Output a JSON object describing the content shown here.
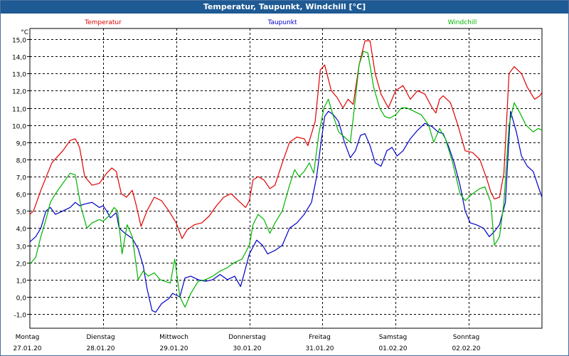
{
  "window_title": "Temperatur, Taupunkt, Windchill [°C]",
  "chart_data": {
    "type": "line",
    "title": "Temperatur, Taupunkt, Windchill [°C]",
    "yunit": "°C",
    "ylim": [
      -1.0,
      15.0
    ],
    "ytick_labels": [
      "-1,0",
      "0,0",
      "1,0",
      "2,0",
      "3,0",
      "4,0",
      "5,0",
      "6,0",
      "7,0",
      "8,0",
      "9,0",
      "10,0",
      "11,0",
      "12,0",
      "13,0",
      "14,0",
      "15,0"
    ],
    "x_range_days": [
      0,
      7
    ],
    "day_labels": [
      {
        "weekday": "Montag",
        "date": "27.01.20"
      },
      {
        "weekday": "Dienstag",
        "date": "28.01.20"
      },
      {
        "weekday": "Mittwoch",
        "date": "29.01.20"
      },
      {
        "weekday": "Donnerstag",
        "date": "30.01.20"
      },
      {
        "weekday": "Freitag",
        "date": "31.01.20"
      },
      {
        "weekday": "Samstag",
        "date": "01.02.20"
      },
      {
        "weekday": "Sonntag",
        "date": "02.02.20"
      }
    ],
    "grid": true,
    "legend_position": "top",
    "series": [
      {
        "name": "Temperatur",
        "color": "#e00000",
        "points": [
          [
            0,
            4.8
          ],
          [
            0.05,
            5.0
          ],
          [
            0.15,
            6.2
          ],
          [
            0.3,
            7.8
          ],
          [
            0.45,
            8.5
          ],
          [
            0.55,
            9.1
          ],
          [
            0.62,
            9.2
          ],
          [
            0.68,
            8.7
          ],
          [
            0.75,
            7.0
          ],
          [
            0.85,
            6.5
          ],
          [
            0.95,
            6.6
          ],
          [
            1.05,
            7.2
          ],
          [
            1.12,
            7.5
          ],
          [
            1.18,
            7.3
          ],
          [
            1.25,
            6.0
          ],
          [
            1.32,
            5.8
          ],
          [
            1.4,
            6.2
          ],
          [
            1.45,
            5.4
          ],
          [
            1.52,
            4.1
          ],
          [
            1.6,
            5.0
          ],
          [
            1.7,
            5.8
          ],
          [
            1.8,
            5.6
          ],
          [
            1.9,
            5.0
          ],
          [
            2.0,
            4.3
          ],
          [
            2.08,
            3.4
          ],
          [
            2.15,
            3.9
          ],
          [
            2.25,
            4.2
          ],
          [
            2.35,
            4.3
          ],
          [
            2.45,
            4.7
          ],
          [
            2.55,
            5.3
          ],
          [
            2.65,
            5.8
          ],
          [
            2.75,
            6.0
          ],
          [
            2.85,
            5.6
          ],
          [
            2.95,
            5.2
          ],
          [
            3.0,
            5.6
          ],
          [
            3.05,
            6.8
          ],
          [
            3.12,
            7.0
          ],
          [
            3.2,
            6.8
          ],
          [
            3.28,
            6.3
          ],
          [
            3.35,
            6.5
          ],
          [
            3.45,
            7.8
          ],
          [
            3.55,
            9.0
          ],
          [
            3.65,
            9.3
          ],
          [
            3.75,
            9.2
          ],
          [
            3.8,
            8.8
          ],
          [
            3.9,
            10.2
          ],
          [
            3.97,
            13.2
          ],
          [
            4.03,
            13.5
          ],
          [
            4.12,
            12.0
          ],
          [
            4.2,
            11.6
          ],
          [
            4.28,
            11.0
          ],
          [
            4.35,
            11.5
          ],
          [
            4.42,
            11.2
          ],
          [
            4.5,
            13.5
          ],
          [
            4.58,
            14.9
          ],
          [
            4.65,
            14.9
          ],
          [
            4.72,
            13.0
          ],
          [
            4.8,
            11.8
          ],
          [
            4.9,
            11.0
          ],
          [
            5.0,
            12.0
          ],
          [
            5.1,
            12.3
          ],
          [
            5.2,
            11.5
          ],
          [
            5.3,
            12.0
          ],
          [
            5.4,
            11.8
          ],
          [
            5.5,
            11.0
          ],
          [
            5.55,
            10.7
          ],
          [
            5.6,
            11.5
          ],
          [
            5.65,
            11.7
          ],
          [
            5.75,
            11.3
          ],
          [
            5.85,
            10.0
          ],
          [
            5.95,
            8.5
          ],
          [
            6.05,
            8.4
          ],
          [
            6.15,
            8.0
          ],
          [
            6.25,
            6.8
          ],
          [
            6.3,
            6.1
          ],
          [
            6.35,
            5.7
          ],
          [
            6.42,
            5.8
          ],
          [
            6.48,
            7.2
          ],
          [
            6.55,
            13.0
          ],
          [
            6.62,
            13.4
          ],
          [
            6.72,
            13.0
          ],
          [
            6.8,
            12.2
          ],
          [
            6.9,
            11.5
          ],
          [
            6.97,
            11.7
          ],
          [
            7.0,
            11.9
          ]
        ]
      },
      {
        "name": "Taupunkt",
        "color": "#0000c8",
        "points": [
          [
            0,
            3.2
          ],
          [
            0.08,
            3.5
          ],
          [
            0.15,
            4.0
          ],
          [
            0.22,
            5.0
          ],
          [
            0.28,
            5.2
          ],
          [
            0.35,
            4.8
          ],
          [
            0.45,
            5.0
          ],
          [
            0.55,
            5.2
          ],
          [
            0.62,
            5.5
          ],
          [
            0.68,
            5.3
          ],
          [
            0.75,
            5.4
          ],
          [
            0.85,
            5.5
          ],
          [
            0.95,
            5.2
          ],
          [
            1.0,
            5.3
          ],
          [
            1.05,
            5.0
          ],
          [
            1.1,
            4.6
          ],
          [
            1.18,
            4.9
          ],
          [
            1.22,
            4.0
          ],
          [
            1.3,
            3.7
          ],
          [
            1.4,
            3.4
          ],
          [
            1.48,
            2.8
          ],
          [
            1.55,
            1.8
          ],
          [
            1.6,
            0.5
          ],
          [
            1.67,
            -0.8
          ],
          [
            1.72,
            -0.9
          ],
          [
            1.8,
            -0.4
          ],
          [
            1.9,
            -0.1
          ],
          [
            1.95,
            0.2
          ],
          [
            2.0,
            0.1
          ],
          [
            2.05,
            0.0
          ],
          [
            2.12,
            1.1
          ],
          [
            2.2,
            1.2
          ],
          [
            2.3,
            1.0
          ],
          [
            2.4,
            0.9
          ],
          [
            2.5,
            1.0
          ],
          [
            2.6,
            1.3
          ],
          [
            2.7,
            1.0
          ],
          [
            2.8,
            1.2
          ],
          [
            2.88,
            0.6
          ],
          [
            2.92,
            1.2
          ],
          [
            3.0,
            2.5
          ],
          [
            3.1,
            3.3
          ],
          [
            3.18,
            3.0
          ],
          [
            3.25,
            2.5
          ],
          [
            3.35,
            2.7
          ],
          [
            3.45,
            3.0
          ],
          [
            3.55,
            4.0
          ],
          [
            3.65,
            4.3
          ],
          [
            3.75,
            4.8
          ],
          [
            3.85,
            5.5
          ],
          [
            3.92,
            7.0
          ],
          [
            3.98,
            9.0
          ],
          [
            4.03,
            10.5
          ],
          [
            4.08,
            10.8
          ],
          [
            4.15,
            10.6
          ],
          [
            4.22,
            10.2
          ],
          [
            4.3,
            9.0
          ],
          [
            4.38,
            8.1
          ],
          [
            4.45,
            8.5
          ],
          [
            4.52,
            9.4
          ],
          [
            4.58,
            9.5
          ],
          [
            4.65,
            8.8
          ],
          [
            4.72,
            7.8
          ],
          [
            4.8,
            7.6
          ],
          [
            4.88,
            8.5
          ],
          [
            4.95,
            8.7
          ],
          [
            5.02,
            8.2
          ],
          [
            5.1,
            8.5
          ],
          [
            5.2,
            9.2
          ],
          [
            5.3,
            9.7
          ],
          [
            5.4,
            10.1
          ],
          [
            5.5,
            9.9
          ],
          [
            5.58,
            9.6
          ],
          [
            5.65,
            9.5
          ],
          [
            5.72,
            8.8
          ],
          [
            5.8,
            7.8
          ],
          [
            5.88,
            6.5
          ],
          [
            5.95,
            5.0
          ],
          [
            6.02,
            4.3
          ],
          [
            6.1,
            4.2
          ],
          [
            6.2,
            4.0
          ],
          [
            6.28,
            3.5
          ],
          [
            6.35,
            3.8
          ],
          [
            6.42,
            4.2
          ],
          [
            6.5,
            5.5
          ],
          [
            6.57,
            10.8
          ],
          [
            6.65,
            9.6
          ],
          [
            6.72,
            8.2
          ],
          [
            6.8,
            7.6
          ],
          [
            6.88,
            7.3
          ],
          [
            6.95,
            6.4
          ],
          [
            7.0,
            5.8
          ]
        ]
      },
      {
        "name": "Windchill",
        "color": "#00b400",
        "points": [
          [
            0,
            1.9
          ],
          [
            0.08,
            2.3
          ],
          [
            0.15,
            3.5
          ],
          [
            0.22,
            4.5
          ],
          [
            0.28,
            5.5
          ],
          [
            0.35,
            6.0
          ],
          [
            0.45,
            6.6
          ],
          [
            0.55,
            7.2
          ],
          [
            0.62,
            7.1
          ],
          [
            0.7,
            5.2
          ],
          [
            0.78,
            4.0
          ],
          [
            0.85,
            4.3
          ],
          [
            0.95,
            4.5
          ],
          [
            1.0,
            4.4
          ],
          [
            1.08,
            4.7
          ],
          [
            1.15,
            5.2
          ],
          [
            1.2,
            5.0
          ],
          [
            1.26,
            2.5
          ],
          [
            1.33,
            4.2
          ],
          [
            1.4,
            3.5
          ],
          [
            1.48,
            1.0
          ],
          [
            1.55,
            1.5
          ],
          [
            1.62,
            1.2
          ],
          [
            1.7,
            1.4
          ],
          [
            1.78,
            1.0
          ],
          [
            1.85,
            0.9
          ],
          [
            1.92,
            0.8
          ],
          [
            1.98,
            2.2
          ],
          [
            2.05,
            0.0
          ],
          [
            2.12,
            -0.6
          ],
          [
            2.2,
            0.2
          ],
          [
            2.3,
            0.9
          ],
          [
            2.4,
            1.0
          ],
          [
            2.5,
            1.2
          ],
          [
            2.6,
            1.5
          ],
          [
            2.7,
            1.7
          ],
          [
            2.8,
            2.0
          ],
          [
            2.9,
            2.2
          ],
          [
            3.0,
            3.0
          ],
          [
            3.05,
            4.2
          ],
          [
            3.12,
            4.8
          ],
          [
            3.2,
            4.5
          ],
          [
            3.28,
            3.7
          ],
          [
            3.35,
            4.3
          ],
          [
            3.45,
            5.0
          ],
          [
            3.55,
            6.5
          ],
          [
            3.62,
            7.4
          ],
          [
            3.68,
            7.0
          ],
          [
            3.75,
            7.3
          ],
          [
            3.82,
            7.8
          ],
          [
            3.88,
            7.2
          ],
          [
            3.95,
            9.5
          ],
          [
            4.02,
            11.0
          ],
          [
            4.08,
            11.5
          ],
          [
            4.15,
            10.5
          ],
          [
            4.22,
            9.6
          ],
          [
            4.3,
            9.3
          ],
          [
            4.38,
            9.0
          ],
          [
            4.42,
            10.4
          ],
          [
            4.5,
            13.5
          ],
          [
            4.56,
            14.3
          ],
          [
            4.62,
            14.2
          ],
          [
            4.7,
            12.2
          ],
          [
            4.78,
            11.0
          ],
          [
            4.85,
            10.5
          ],
          [
            4.92,
            10.4
          ],
          [
            5.0,
            10.6
          ],
          [
            5.08,
            11.0
          ],
          [
            5.15,
            11.0
          ],
          [
            5.25,
            10.8
          ],
          [
            5.35,
            10.6
          ],
          [
            5.45,
            10.0
          ],
          [
            5.52,
            9.0
          ],
          [
            5.6,
            9.8
          ],
          [
            5.68,
            9.2
          ],
          [
            5.78,
            7.8
          ],
          [
            5.88,
            6.0
          ],
          [
            5.95,
            5.6
          ],
          [
            6.05,
            6.0
          ],
          [
            6.15,
            6.3
          ],
          [
            6.22,
            6.4
          ],
          [
            6.3,
            5.5
          ],
          [
            6.35,
            3.0
          ],
          [
            6.42,
            3.5
          ],
          [
            6.48,
            5.5
          ],
          [
            6.55,
            10.0
          ],
          [
            6.62,
            11.3
          ],
          [
            6.7,
            10.7
          ],
          [
            6.78,
            10.0
          ],
          [
            6.88,
            9.6
          ],
          [
            6.95,
            9.8
          ],
          [
            7.0,
            9.7
          ]
        ]
      }
    ]
  }
}
